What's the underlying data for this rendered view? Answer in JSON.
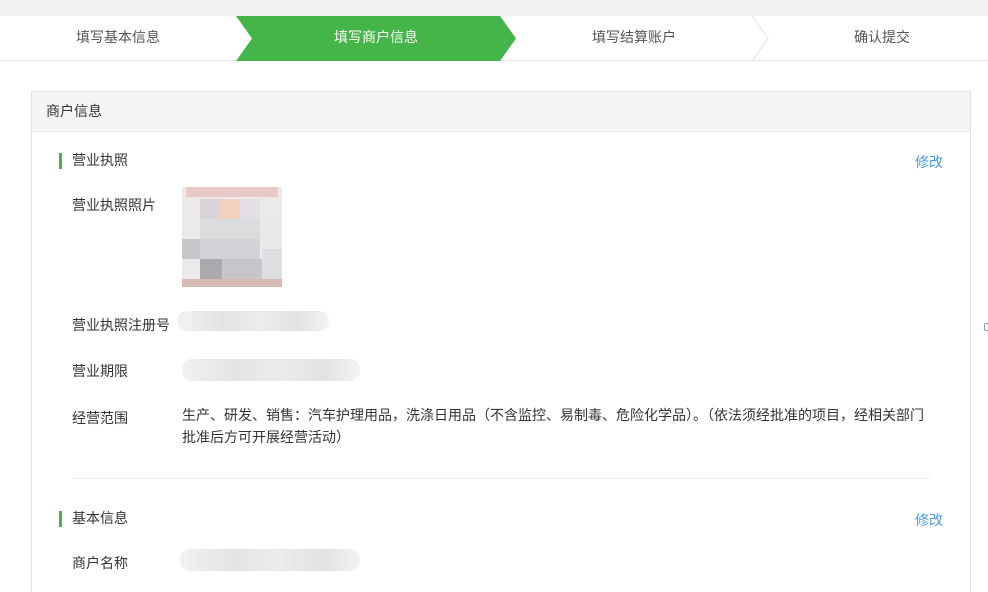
{
  "steps": [
    {
      "label": "填写基本信息",
      "state": "done"
    },
    {
      "label": "填写商户信息",
      "state": "active"
    },
    {
      "label": "填写结算账户",
      "state": "pending"
    },
    {
      "label": "确认提交",
      "state": "pending"
    }
  ],
  "colors": {
    "accent": "#44b549",
    "link": "#459ae9"
  },
  "panel": {
    "title": "商户信息"
  },
  "license_section": {
    "title": "营业执照",
    "edit_label": "修改",
    "photo_label": "营业执照照片",
    "reg_no_label": "营业执照注册号",
    "period_label": "营业期限",
    "scope_label": "经营范围",
    "scope_value": "生产、研发、销售：汽车护理用品，洗涤日用品（不含监控、易制毒、危险化学品）。（依法须经批准的项目，经相关部门批准后方可开展经营活动）"
  },
  "basic_section": {
    "title": "基本信息",
    "edit_label": "修改",
    "merchant_name_label": "商户名称"
  }
}
